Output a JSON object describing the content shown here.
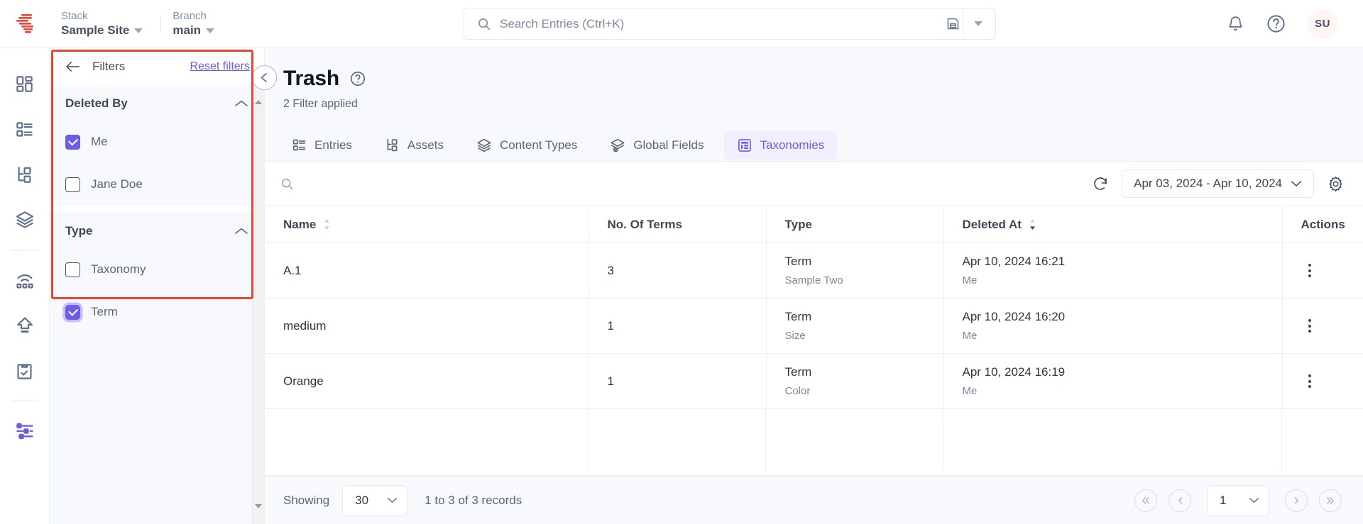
{
  "topbar": {
    "logo_icon": "contentstack-logo-icon",
    "stack": {
      "label": "Stack",
      "value": "Sample Site"
    },
    "branch": {
      "label": "Branch",
      "value": "main"
    },
    "search": {
      "placeholder": "Search Entries (Ctrl+K)",
      "value": "",
      "icon": "search-icon",
      "save_icon": "floppy-disk-icon",
      "caret_icon": "caret-down-icon"
    },
    "notifications_icon": "bell-icon",
    "help_icon": "question-circle-icon",
    "avatar_initials": "SU"
  },
  "rail": {
    "items": [
      {
        "name": "dashboard",
        "icon": "dashboard-grid-icon",
        "active": false
      },
      {
        "name": "entries",
        "icon": "entries-list-icon",
        "active": false
      },
      {
        "name": "assets",
        "icon": "assets-tree-icon",
        "active": false
      },
      {
        "name": "stack",
        "icon": "layers-stack-icon",
        "active": false
      },
      {
        "name": "live-preview",
        "icon": "broadcast-icon",
        "active": false
      },
      {
        "name": "releases",
        "icon": "upload-arrow-icon",
        "active": false
      },
      {
        "name": "tasks",
        "icon": "clipboard-check-icon",
        "active": false
      },
      {
        "name": "trash-settings",
        "icon": "sliders-icon",
        "active": true
      }
    ]
  },
  "filters": {
    "back_icon": "arrow-left-icon",
    "title": "Filters",
    "reset_label": "Reset filters",
    "groups": [
      {
        "title": "Deleted By",
        "collapse_icon": "chevron-up-icon",
        "options": [
          {
            "label": "Me",
            "checked": true,
            "focused": false
          },
          {
            "label": "Jane Doe",
            "checked": false,
            "focused": false
          }
        ]
      },
      {
        "title": "Type",
        "collapse_icon": "chevron-up-icon",
        "options": [
          {
            "label": "Taxonomy",
            "checked": false,
            "focused": false
          },
          {
            "label": "Term",
            "checked": true,
            "focused": true
          }
        ]
      }
    ]
  },
  "page": {
    "collapse_icon": "chevron-left-icon",
    "title": "Trash",
    "help_icon": "question-circle-icon",
    "subtitle": "2 Filter applied"
  },
  "tabs": [
    {
      "label": "Entries",
      "icon": "entries-list-icon",
      "active": false
    },
    {
      "label": "Assets",
      "icon": "assets-tree-icon",
      "active": false
    },
    {
      "label": "Content Types",
      "icon": "layers-stack-icon",
      "active": false
    },
    {
      "label": "Global Fields",
      "icon": "global-fields-icon",
      "active": false
    },
    {
      "label": "Taxonomies",
      "icon": "taxonomies-icon",
      "active": true
    }
  ],
  "toolbar": {
    "search": {
      "placeholder": "",
      "value": "",
      "icon": "search-icon"
    },
    "refresh_icon": "refresh-icon",
    "date_range": "Apr 03, 2024 - Apr 10, 2024",
    "date_caret_icon": "chevron-down-icon",
    "settings_icon": "gear-icon"
  },
  "table": {
    "columns": [
      {
        "label": "Name",
        "sort_icon": "sort-both-icon",
        "sort_state": "none"
      },
      {
        "label": "No. Of Terms",
        "sort_icon": "",
        "sort_state": "none"
      },
      {
        "label": "Type",
        "sort_icon": "",
        "sort_state": "none"
      },
      {
        "label": "Deleted At",
        "sort_icon": "sort-desc-icon",
        "sort_state": "desc"
      },
      {
        "label": "Actions",
        "sort_icon": "",
        "sort_state": "none"
      }
    ],
    "rows": [
      {
        "name": "A.1",
        "terms": "3",
        "type": "Term",
        "type_sub": "Sample Two",
        "deleted_at": "Apr 10, 2024 16:21",
        "deleted_by": "Me",
        "actions_icon": "kebab-menu-icon"
      },
      {
        "name": "medium",
        "terms": "1",
        "type": "Term",
        "type_sub": "Size",
        "deleted_at": "Apr 10, 2024 16:20",
        "deleted_by": "Me",
        "actions_icon": "kebab-menu-icon"
      },
      {
        "name": "Orange",
        "terms": "1",
        "type": "Term",
        "type_sub": "Color",
        "deleted_at": "Apr 10, 2024 16:19",
        "deleted_by": "Me",
        "actions_icon": "kebab-menu-icon"
      }
    ]
  },
  "footer": {
    "showing_label": "Showing",
    "page_size": "30",
    "records_text": "1 to 3 of 3 records",
    "first_icon": "double-chevron-left-icon",
    "prev_icon": "chevron-left-icon",
    "current_page": "1",
    "next_icon": "chevron-right-icon",
    "last_icon": "double-chevron-right-icon"
  },
  "colors": {
    "accent": "#6c5ce7",
    "accent_soft": "#f1eefe",
    "annotation": "#f0432f",
    "text": "#475161",
    "muted": "#7b889c",
    "border": "#eaedf3",
    "panel_bg": "#f8f9fc",
    "logo": "#e4483a"
  }
}
